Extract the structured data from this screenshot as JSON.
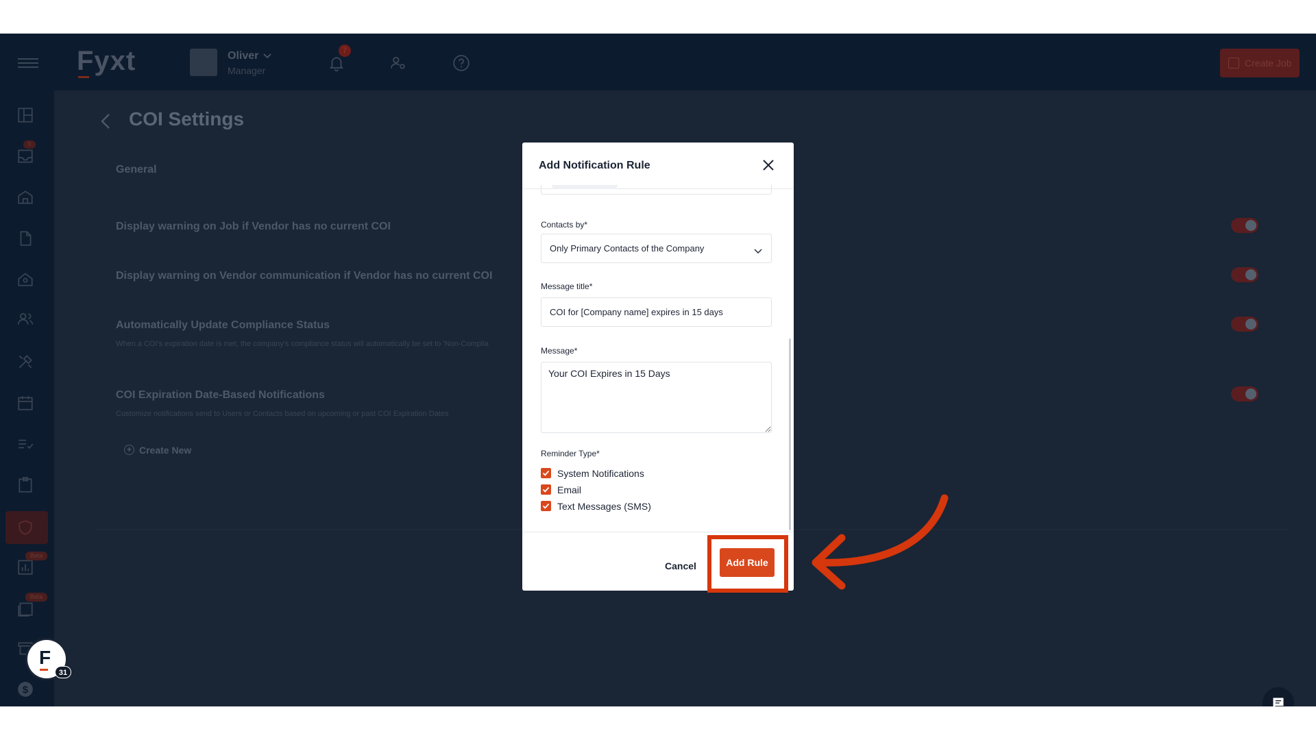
{
  "app": {
    "logo": "Fyxt"
  },
  "header": {
    "user_name": "Oliver",
    "user_role": "Manager",
    "notification_count": "7",
    "create_job_label": "Create Job"
  },
  "sidebar": {
    "inbox_badge": "0",
    "beta_label": "Beta"
  },
  "page": {
    "title": "COI Settings",
    "section": "General",
    "settings": [
      {
        "title": "Display warning on Job if Vendor has no current COI",
        "desc": "",
        "enabled": true
      },
      {
        "title": "Display warning on Vendor communication if Vendor has no current COI",
        "desc": "",
        "enabled": true
      },
      {
        "title": "Automatically Update Compliance Status",
        "desc": "When a COI's expiration date is met, the company's compliance status will automatically be set to 'Non-Complia",
        "enabled": true
      },
      {
        "title": "COI Expiration Date-Based Notifications",
        "desc": "Customize notifications send to Users or Contacts based on upcoming or past COI Expiration Dates",
        "enabled": true
      }
    ],
    "create_new_label": "Create New"
  },
  "modal": {
    "title": "Add Notification Rule",
    "contacts_label": "Contacts by*",
    "contacts_value": "Only Primary Contacts of the Company",
    "message_title_label": "Message title*",
    "message_title_value": "COI for [Company name] expires in 15 days",
    "message_label": "Message*",
    "message_value": "Your COI Expires in 15 Days",
    "reminder_label": "Reminder Type*",
    "reminders": [
      {
        "label": "System Notifications",
        "checked": true
      },
      {
        "label": "Email",
        "checked": true
      },
      {
        "label": "Text Messages (SMS)",
        "checked": true
      }
    ],
    "cancel_label": "Cancel",
    "add_label": "Add Rule"
  },
  "widgets": {
    "fab_letter": "F",
    "fab_count": "31"
  },
  "colors": {
    "accent": "#d9481c",
    "annotation": "#d6370c",
    "nav_bg": "#0d1b2e"
  },
  "icons": {
    "close": "close-icon",
    "chevron": "chevron-down-icon",
    "check": "check-icon",
    "arrow": "annotation-arrow-icon",
    "chat": "chat-icon"
  }
}
